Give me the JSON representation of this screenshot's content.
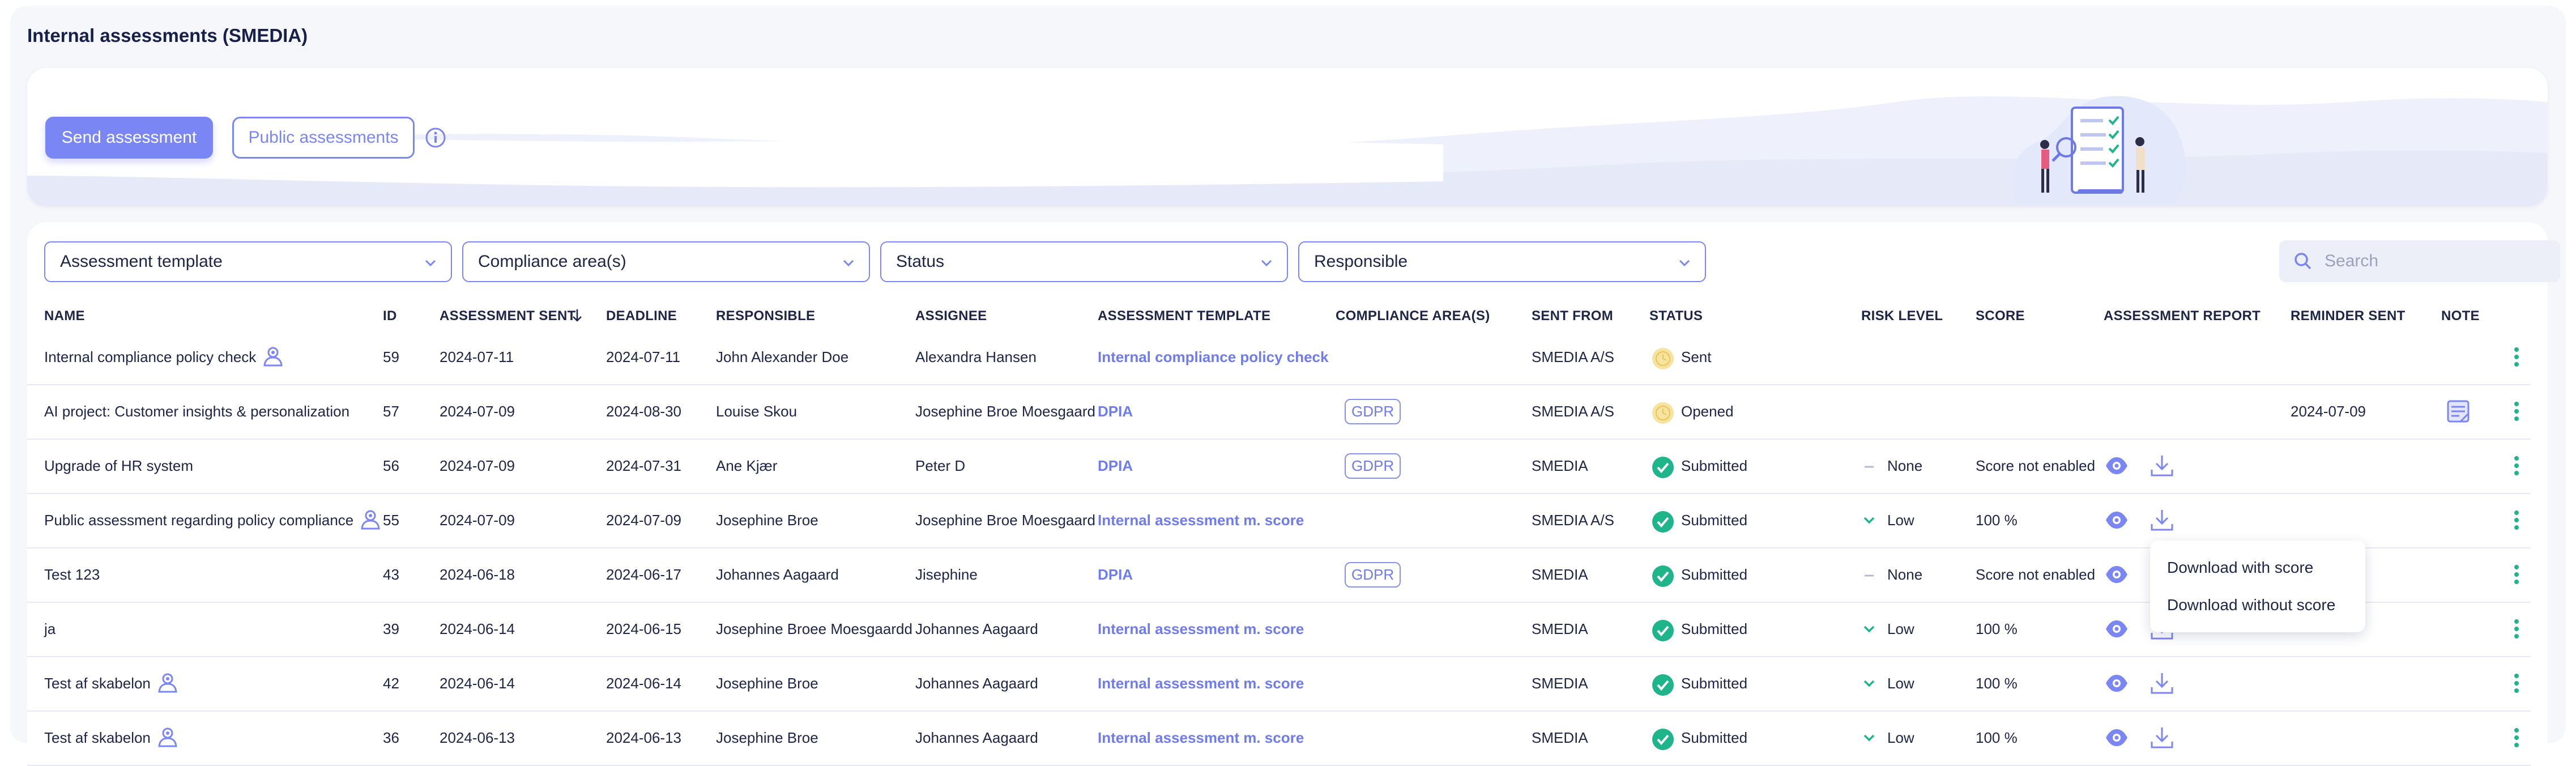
{
  "page": {
    "title": "Internal assessments (SMEDIA)"
  },
  "banner": {
    "send_label": "Send assessment",
    "public_label": "Public assessments"
  },
  "filters": {
    "template": "Assessment template",
    "compliance": "Compliance area(s)",
    "status": "Status",
    "responsible": "Responsible",
    "search_placeholder": "Search"
  },
  "columns": [
    "NAME",
    "ID",
    "ASSESSMENT SENT",
    "DEADLINE",
    "RESPONSIBLE",
    "ASSIGNEE",
    "ASSESSMENT TEMPLATE",
    "COMPLIANCE AREA(S)",
    "SENT FROM",
    "STATUS",
    "RISK LEVEL",
    "SCORE",
    "ASSESSMENT REPORT",
    "REMINDER SENT",
    "NOTE"
  ],
  "rows": [
    {
      "name": "Internal compliance policy check",
      "public_icon": true,
      "id": "59",
      "sent": "2024-07-11",
      "deadline": "2024-07-11",
      "responsible": "John Alexander Doe",
      "assignee": "Alexandra Hansen",
      "template": "Internal compliance policy check",
      "compliance": "",
      "sent_from": "SMEDIA A/S",
      "status": "Sent",
      "status_kind": "pending",
      "risk": "",
      "risk_kind": "",
      "score": "",
      "report": false,
      "reminder": "",
      "note": false
    },
    {
      "name": "AI project: Customer insights & personalization",
      "public_icon": false,
      "id": "57",
      "sent": "2024-07-09",
      "deadline": "2024-08-30",
      "responsible": "Louise Skou",
      "assignee": "Josephine Broe Moesgaard",
      "template": "DPIA",
      "compliance": "GDPR",
      "sent_from": "SMEDIA A/S",
      "status": "Opened",
      "status_kind": "pending",
      "risk": "",
      "risk_kind": "",
      "score": "",
      "report": false,
      "reminder": "2024-07-09",
      "note": true
    },
    {
      "name": "Upgrade of HR system",
      "public_icon": false,
      "id": "56",
      "sent": "2024-07-09",
      "deadline": "2024-07-31",
      "responsible": "Ane Kjær",
      "assignee": "Peter D",
      "template": "DPIA",
      "compliance": "GDPR",
      "sent_from": "SMEDIA",
      "status": "Submitted",
      "status_kind": "done",
      "risk": "None",
      "risk_kind": "none",
      "score": "Score not enabled",
      "report": true,
      "reminder": "",
      "note": false
    },
    {
      "name": "Public assessment regarding policy compliance",
      "public_icon": true,
      "id": "55",
      "sent": "2024-07-09",
      "deadline": "2024-07-09",
      "responsible": "Josephine Broe",
      "assignee": "Josephine Broe Moesgaard",
      "template": "Internal assessment m. score",
      "compliance": "",
      "sent_from": "SMEDIA A/S",
      "status": "Submitted",
      "status_kind": "done",
      "risk": "Low",
      "risk_kind": "low",
      "score": "100 %",
      "report": true,
      "reminder": "",
      "note": false
    },
    {
      "name": "Test 123",
      "public_icon": false,
      "id": "43",
      "sent": "2024-06-18",
      "deadline": "2024-06-17",
      "responsible": "Johannes Aagaard",
      "assignee": "Jisephine",
      "template": "DPIA",
      "compliance": "GDPR",
      "sent_from": "SMEDIA",
      "status": "Submitted",
      "status_kind": "done",
      "risk": "None",
      "risk_kind": "none",
      "score": "Score not enabled",
      "report": true,
      "reminder": "",
      "note": false
    },
    {
      "name": "ja",
      "public_icon": false,
      "id": "39",
      "sent": "2024-06-14",
      "deadline": "2024-06-15",
      "responsible": "Josephine Broee Moesgaardd",
      "assignee": "Johannes Aagaard",
      "template": "Internal assessment m. score",
      "compliance": "",
      "sent_from": "SMEDIA",
      "status": "Submitted",
      "status_kind": "done",
      "risk": "Low",
      "risk_kind": "low",
      "score": "100 %",
      "report": true,
      "reminder": "",
      "note": false
    },
    {
      "name": "Test af skabelon",
      "public_icon": true,
      "id": "42",
      "sent": "2024-06-14",
      "deadline": "2024-06-14",
      "responsible": "Josephine Broe",
      "assignee": "Johannes Aagaard",
      "template": "Internal assessment m. score",
      "compliance": "",
      "sent_from": "SMEDIA",
      "status": "Submitted",
      "status_kind": "done",
      "risk": "Low",
      "risk_kind": "low",
      "score": "100 %",
      "report": true,
      "reminder": "",
      "note": false
    },
    {
      "name": "Test af skabelon",
      "public_icon": true,
      "id": "36",
      "sent": "2024-06-13",
      "deadline": "2024-06-13",
      "responsible": "Josephine Broe",
      "assignee": "Johannes Aagaard",
      "template": "Internal assessment m. score",
      "compliance": "",
      "sent_from": "SMEDIA",
      "status": "Submitted",
      "status_kind": "done",
      "risk": "Low",
      "risk_kind": "low",
      "score": "100 %",
      "report": true,
      "reminder": "",
      "note": false
    }
  ],
  "download_menu": {
    "with_score": "Download with score",
    "without_score": "Download without score"
  },
  "colors": {
    "accent": "#7b86f5",
    "success": "#1fb58a",
    "pending": "#f5dc8a"
  }
}
